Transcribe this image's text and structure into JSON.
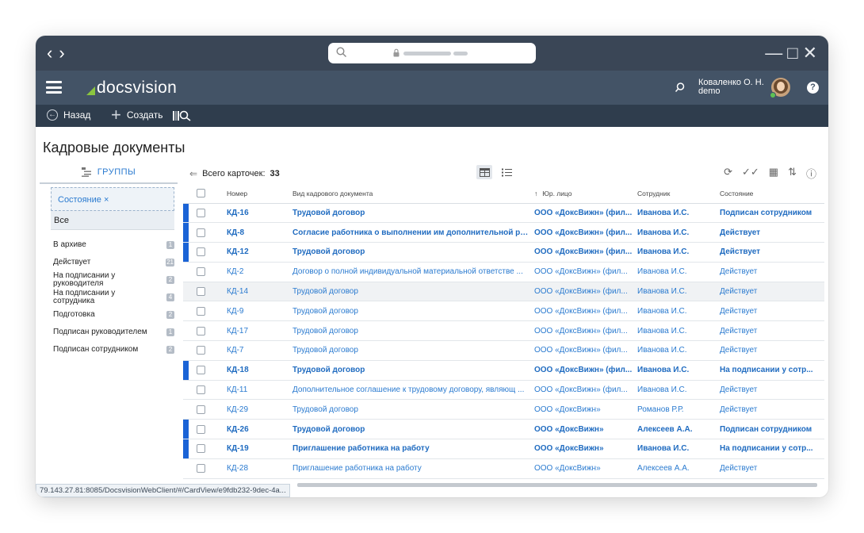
{
  "browser": {
    "back_icon": "chevron-left-icon",
    "forward_icon": "chevron-right-icon"
  },
  "header": {
    "logo": "docsvision",
    "user_name": "Коваленко О. Н.",
    "user_login": "demo",
    "help": "?"
  },
  "toolbar": {
    "back_label": "Назад",
    "create_label": "Создать"
  },
  "page": {
    "title": "Кадровые документы"
  },
  "sidebar": {
    "groups_label": "ГРУППЫ",
    "filter_chip": "Состояние  ×",
    "all_label": "Все",
    "items": [
      {
        "label": "В архиве",
        "count": "1"
      },
      {
        "label": "Действует",
        "count": "21"
      },
      {
        "label": "На подписании у руководителя",
        "count": "2"
      },
      {
        "label": "На подписании у сотрудника",
        "count": "4"
      },
      {
        "label": "Подготовка",
        "count": "2"
      },
      {
        "label": "Подписан руководителем",
        "count": "1"
      },
      {
        "label": "Подписан сотрудником",
        "count": "2"
      }
    ]
  },
  "list": {
    "total_label": "Всего карточек:",
    "total_count": "33",
    "columns": [
      "Номер",
      "Вид кадрового документа",
      "Юр. лицо",
      "Сотрудник",
      "Состояние"
    ],
    "sort_indicator": "↑",
    "rows": [
      {
        "num": "КД-16",
        "kind": "Трудовой договор",
        "entity": "ООО «ДоксВижн» (фил...",
        "employee": "Иванова И.С.",
        "state": "Подписан сотрудником",
        "unread": true
      },
      {
        "num": "КД-8",
        "kind": "Согласие работника о выполнении им дополнительной рабо ...",
        "entity": "ООО «ДоксВижн» (фил...",
        "employee": "Иванова И.С.",
        "state": "Действует",
        "unread": true
      },
      {
        "num": "КД-12",
        "kind": "Трудовой договор",
        "entity": "ООО «ДоксВижн» (фил...",
        "employee": "Иванова И.С.",
        "state": "Действует",
        "unread": true
      },
      {
        "num": "КД-2",
        "kind": "Договор о полной индивидуальной материальной ответстве ...",
        "entity": "ООО «ДоксВижн» (фил...",
        "employee": "Иванова И.С.",
        "state": "Действует",
        "unread": false
      },
      {
        "num": "КД-14",
        "kind": "Трудовой договор",
        "entity": "ООО «ДоксВижн» (фил...",
        "employee": "Иванова И.С.",
        "state": "Действует",
        "unread": false
      },
      {
        "num": "КД-9",
        "kind": "Трудовой договор",
        "entity": "ООО «ДоксВижн» (фил...",
        "employee": "Иванова И.С.",
        "state": "Действует",
        "unread": false
      },
      {
        "num": "КД-17",
        "kind": "Трудовой договор",
        "entity": "ООО «ДоксВижн» (фил...",
        "employee": "Иванова И.С.",
        "state": "Действует",
        "unread": false
      },
      {
        "num": "КД-7",
        "kind": "Трудовой договор",
        "entity": "ООО «ДоксВижн» (фил...",
        "employee": "Иванова И.С.",
        "state": "Действует",
        "unread": false
      },
      {
        "num": "КД-18",
        "kind": "Трудовой договор",
        "entity": "ООО «ДоксВижн» (фил...",
        "employee": "Иванова И.С.",
        "state": "На подписании у сотр...",
        "unread": true
      },
      {
        "num": "КД-11",
        "kind": "Дополнительное соглашение к трудовому договору, являющ ...",
        "entity": "ООО «ДоксВижн» (фил...",
        "employee": "Иванова И.С.",
        "state": "Действует",
        "unread": false
      },
      {
        "num": "КД-29",
        "kind": "Трудовой договор",
        "entity": "ООО «ДоксВижн»",
        "employee": "Романов Р.Р.",
        "state": "Действует",
        "unread": false
      },
      {
        "num": "КД-26",
        "kind": "Трудовой договор",
        "entity": "ООО «ДоксВижн»",
        "employee": "Алексеев А.А.",
        "state": "Подписан сотрудником",
        "unread": true
      },
      {
        "num": "КД-19",
        "kind": "Приглашение работника на работу",
        "entity": "ООО «ДоксВижн»",
        "employee": "Иванова И.С.",
        "state": "На подписании у сотр...",
        "unread": true
      },
      {
        "num": "КД-28",
        "kind": "Приглашение работника на работу",
        "entity": "ООО «ДоксВижн»",
        "employee": "Алексеев А.А.",
        "state": "Действует",
        "unread": false
      }
    ]
  },
  "status_url": "79.143.27.81:8085/DocsvisionWebClient/#/CardView/e9fdb232-9dec-4a...",
  "colors": {
    "header": "#435366",
    "toolbar": "#2f3d4d",
    "browser": "#3a4656",
    "link": "#2b7bd0",
    "unread_marker": "#1a63d6"
  }
}
